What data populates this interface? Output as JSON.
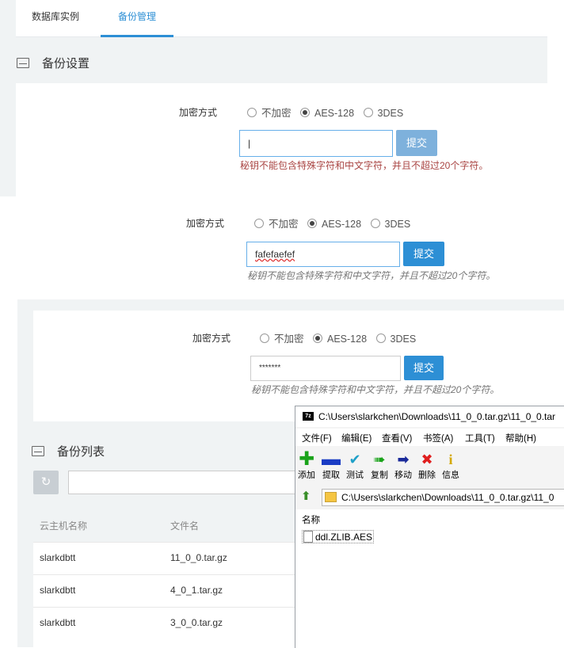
{
  "tabs": [
    "数据库实例",
    "备份管理"
  ],
  "backup_settings": {
    "title": "备份设置"
  },
  "encryption": {
    "label": "加密方式",
    "options": [
      "不加密",
      "AES-128",
      "3DES"
    ],
    "selected": "AES-128",
    "submit": "提交",
    "hint": "秘钥不能包含特殊字符和中文字符，并且不超过20个字符。"
  },
  "inputs": {
    "panel1_value": "|",
    "panel2_value": "fafefaefef",
    "panel3_value": "*******"
  },
  "backup_list": {
    "title": "备份列表",
    "refresh_icon": "↻",
    "columns": [
      "云主机名称",
      "文件名"
    ],
    "rows": [
      [
        "slarkdbtt",
        "11_0_0.tar.gz"
      ],
      [
        "slarkdbtt",
        "4_0_1.tar.gz"
      ],
      [
        "slarkdbtt",
        "3_0_0.tar.gz"
      ]
    ]
  },
  "zip_window": {
    "app_icon": "7z",
    "title": "C:\\Users\\slarkchen\\Downloads\\11_0_0.tar.gz\\11_0_0.tar",
    "menu": [
      "文件(F)",
      "编辑(E)",
      "查看(V)",
      "书签(A)",
      "工具(T)",
      "帮助(H)"
    ],
    "tools": [
      {
        "icon": "plus-icon",
        "label": "添加",
        "color": "#1aa31a"
      },
      {
        "icon": "minus-icon",
        "label": "提取",
        "color": "#1a3cc4"
      },
      {
        "icon": "check-icon",
        "label": "测试",
        "color": "#1fa0c8"
      },
      {
        "icon": "double-arrow-icon",
        "label": "复制",
        "color": "#1aa31a"
      },
      {
        "icon": "arrow-right-icon",
        "label": "移动",
        "color": "#1a2a9a"
      },
      {
        "icon": "x-icon",
        "label": "删除",
        "color": "#e01e1e"
      },
      {
        "icon": "info-icon",
        "label": "信息",
        "color": "#d4a800"
      }
    ],
    "address": "C:\\Users\\slarkchen\\Downloads\\11_0_0.tar.gz\\11_0",
    "list_header": "名称",
    "files": [
      "ddl.ZLIB.AES"
    ]
  }
}
